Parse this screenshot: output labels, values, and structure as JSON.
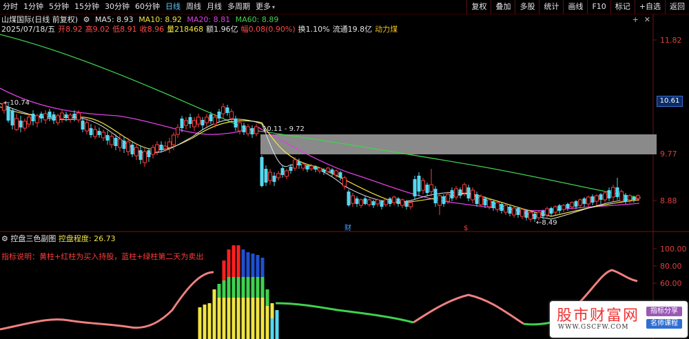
{
  "toolbar": {
    "periods": [
      {
        "label": "分时",
        "active": false
      },
      {
        "label": "1分钟",
        "active": false
      },
      {
        "label": "5分钟",
        "active": false
      },
      {
        "label": "15分钟",
        "active": false
      },
      {
        "label": "30分钟",
        "active": false
      },
      {
        "label": "60分钟",
        "active": false
      },
      {
        "label": "日线",
        "active": true
      },
      {
        "label": "周线",
        "active": false
      },
      {
        "label": "月线",
        "active": false
      },
      {
        "label": "多周期",
        "active": false
      },
      {
        "label": "更多",
        "active": false
      }
    ],
    "buttons": [
      "复权",
      "叠加",
      "多股",
      "统计",
      "画线",
      "F10",
      "标记",
      "+自选",
      "返回"
    ]
  },
  "info": {
    "stock_label": "山煤国际(日线 前复权)",
    "ma5": "MA5: 8.93",
    "ma10": "MA10: 8.92",
    "ma20": "MA20: 8.81",
    "ma60": "MA60: 8.89",
    "date": "2025/07/18/五",
    "open": "开8.92",
    "high": "高9.02",
    "low": "低8.91",
    "close": "收8.96",
    "volume": "量218468",
    "amount": "额1.96亿",
    "change": "幅0.08(0.90%)",
    "turnover": "换1.10%",
    "float": "流通19.8亿",
    "concept": "动力煤"
  },
  "main_chart": {
    "y_labels": [
      "11.82",
      "9.77",
      "8.88"
    ],
    "current_price": "10.61",
    "annotations": {
      "high_label": "10.74",
      "range_label": "10.11 - 9.72",
      "low_label": "8.49",
      "marker_cai": "财",
      "marker_s": "$"
    }
  },
  "sub_chart": {
    "title": "控盘三色副图",
    "degree": "控盘程度: 26.73",
    "description": "指标说明：黄柱+红柱为买入持股，蓝柱+绿柱第二天为卖出",
    "y_labels": [
      "100.00",
      "80.00",
      "60.00"
    ]
  },
  "watermark": {
    "name": "股市财富网",
    "url": "WWW.GSCFW.COM",
    "badge1": "指标分享",
    "badge2": "名师课程"
  },
  "colors": {
    "ma5": "#e6e6e6",
    "ma10": "#f0e442",
    "ma20": "#e040e0",
    "ma60": "#3fd24f",
    "up": "#ff3b3b",
    "down": "#55d8f0",
    "grid_border": "#7a1010"
  }
}
